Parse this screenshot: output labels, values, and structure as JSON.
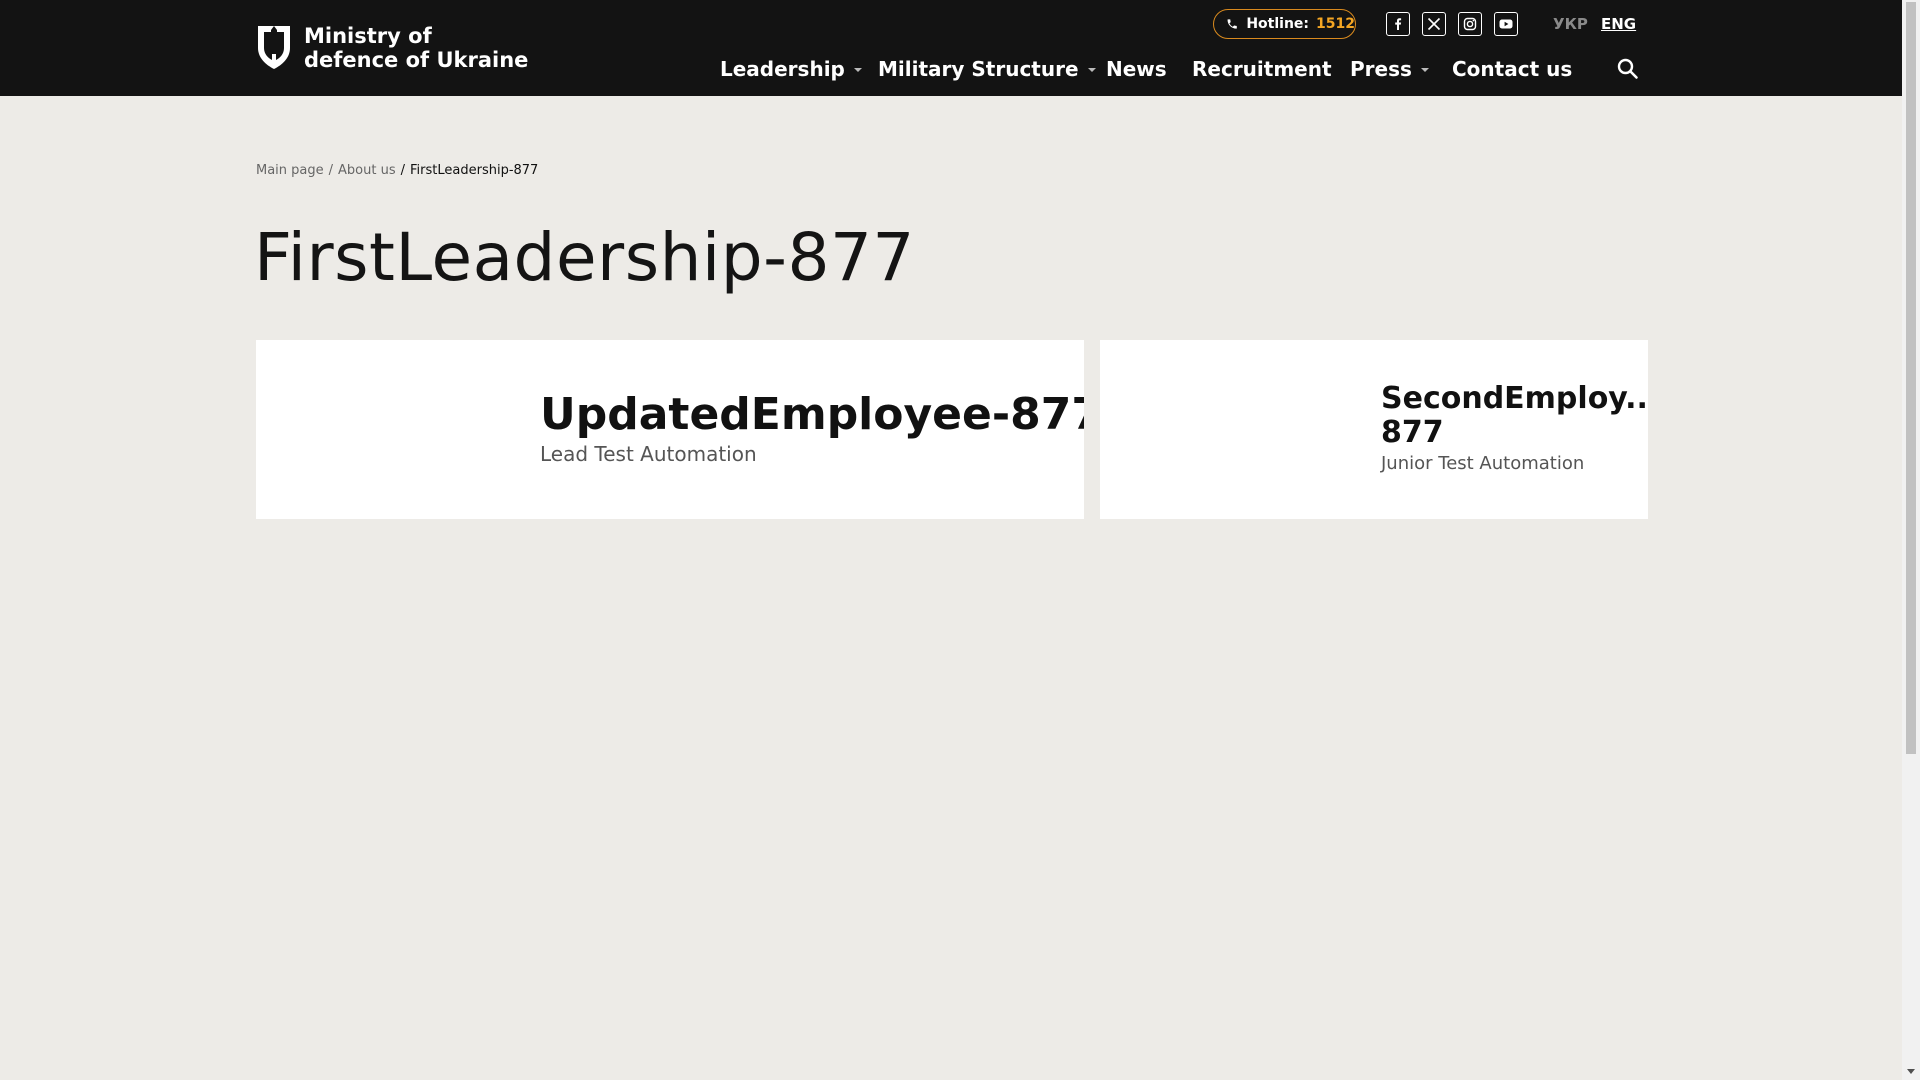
{
  "header": {
    "logo_line1": "Ministry of",
    "logo_line2": "defence of Ukraine",
    "hotline_label": "Hotline:",
    "hotline_number": "1512",
    "socials": [
      "facebook-icon",
      "x-twitter-icon",
      "instagram-icon",
      "youtube-icon"
    ],
    "lang_ukr": "УКР",
    "lang_eng": "ENG",
    "nav": [
      {
        "label": "Leadership",
        "has_dropdown": true
      },
      {
        "label": "Military Structure",
        "has_dropdown": true
      },
      {
        "label": "News",
        "has_dropdown": false
      },
      {
        "label": "Recruitment",
        "has_dropdown": false
      },
      {
        "label": "Press",
        "has_dropdown": true
      },
      {
        "label": "Contact us",
        "has_dropdown": false
      }
    ]
  },
  "breadcrumb": {
    "items": [
      "Main page",
      "About us"
    ],
    "current": "FirstLeadership-877"
  },
  "page_title": "FirstLeadership-877",
  "employees": [
    {
      "name": "UpdatedEmployee-877",
      "role": "Lead Test Automation"
    },
    {
      "name": "SecondEmploy...\n877",
      "name_line1": "SecondEmploy...",
      "name_line2": "877",
      "role": "Junior Test Automation"
    }
  ],
  "colors": {
    "header_bg": "#131313",
    "page_bg": "#edebe7",
    "hotline_accent": "#f5a623",
    "card_bg": "#ffffff"
  }
}
